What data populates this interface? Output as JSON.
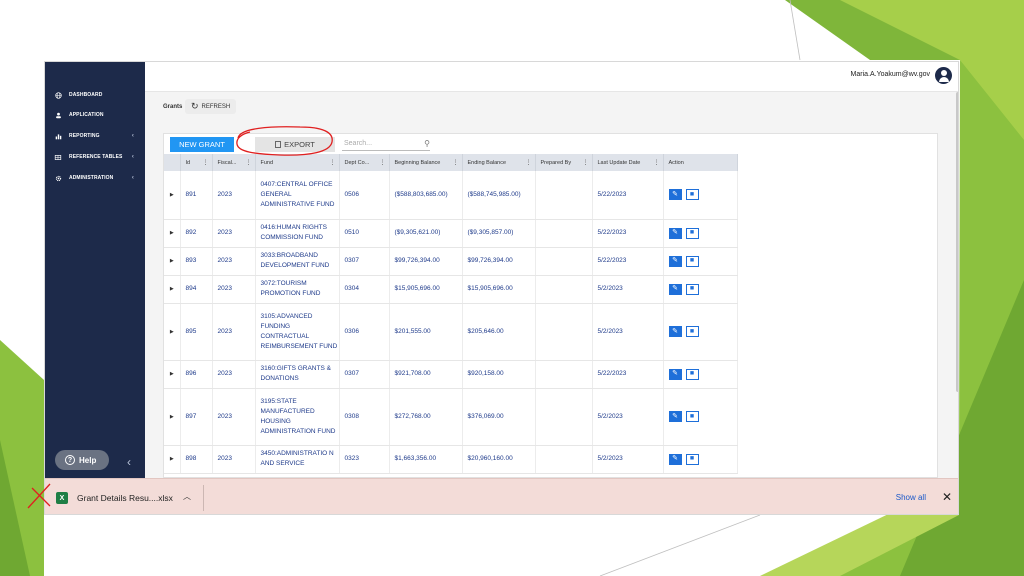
{
  "colors": {
    "sidebar": "#1d2a4a",
    "accent": "#2196f3",
    "link": "#1e3a8a",
    "download_bar": "#f3dcd8",
    "annotation": "#e02020"
  },
  "user": {
    "email": "Maria.A.Yoakum@wv.gov"
  },
  "sidebar": {
    "items": [
      {
        "label": "DASHBOARD",
        "icon": "globe-icon",
        "has_chevron": false
      },
      {
        "label": "APPLICATION",
        "icon": "user-icon",
        "has_chevron": false
      },
      {
        "label": "REPORTING",
        "icon": "chart-icon",
        "has_chevron": true
      },
      {
        "label": "REFERENCE TABLES",
        "icon": "table-icon",
        "has_chevron": true
      },
      {
        "label": "ADMINISTRATION",
        "icon": "gear-icon",
        "has_chevron": true
      }
    ],
    "help_label": "Help"
  },
  "breadcrumb": {
    "title": "Grants",
    "refresh_label": "REFRESH"
  },
  "toolbar": {
    "new_label": "NEW GRANT",
    "export_label": "EXPORT",
    "search_placeholder": "Search..."
  },
  "table": {
    "columns": [
      "Id",
      "Fiscal...",
      "Fund",
      "Dept Co...",
      "Beginning Balance",
      "Ending Balance",
      "Prepared By",
      "Last Update Date",
      "Action"
    ],
    "rows": [
      {
        "id": "891",
        "fiscal": "2023",
        "fund": "0407:CENTRAL OFFICE GENERAL ADMINISTRATIVE FUND",
        "dept": "0506",
        "begin": "($588,803,685.00)",
        "end": "($588,745,985.00)",
        "prepared": "",
        "updated": "5/22/2023"
      },
      {
        "id": "892",
        "fiscal": "2023",
        "fund": "0416:HUMAN RIGHTS COMMISSION FUND",
        "dept": "0510",
        "begin": "($9,305,621.00)",
        "end": "($9,305,857.00)",
        "prepared": "",
        "updated": "5/22/2023"
      },
      {
        "id": "893",
        "fiscal": "2023",
        "fund": "3033:BROADBAND DEVELOPMENT FUND",
        "dept": "0307",
        "begin": "$99,726,394.00",
        "end": "$99,726,394.00",
        "prepared": "",
        "updated": "5/22/2023"
      },
      {
        "id": "894",
        "fiscal": "2023",
        "fund": "3072:TOURISM PROMOTION FUND",
        "dept": "0304",
        "begin": "$15,905,696.00",
        "end": "$15,905,696.00",
        "prepared": "",
        "updated": "5/2/2023"
      },
      {
        "id": "895",
        "fiscal": "2023",
        "fund": "3105:ADVANCED FUNDING CONTRACTUAL REIMBURSEMENT FUND",
        "dept": "0306",
        "begin": "$201,555.00",
        "end": "$205,646.00",
        "prepared": "",
        "updated": "5/2/2023"
      },
      {
        "id": "896",
        "fiscal": "2023",
        "fund": "3160:GIFTS GRANTS & DONATIONS",
        "dept": "0307",
        "begin": "$921,708.00",
        "end": "$920,158.00",
        "prepared": "",
        "updated": "5/22/2023"
      },
      {
        "id": "897",
        "fiscal": "2023",
        "fund": "3195:STATE MANUFACTURED HOUSING ADMINISTRATION FUND",
        "dept": "0308",
        "begin": "$272,768.00",
        "end": "$376,069.00",
        "prepared": "",
        "updated": "5/2/2023"
      },
      {
        "id": "898",
        "fiscal": "2023",
        "fund": "3450:ADMINISTRATIO N AND SERVICE",
        "dept": "0323",
        "begin": "$1,663,356.00",
        "end": "$20,960,160.00",
        "prepared": "",
        "updated": "5/2/2023"
      }
    ]
  },
  "download_bar": {
    "file_name": "Grant Details Resu....xlsx",
    "file_icon": "excel-icon",
    "show_all_label": "Show all"
  }
}
